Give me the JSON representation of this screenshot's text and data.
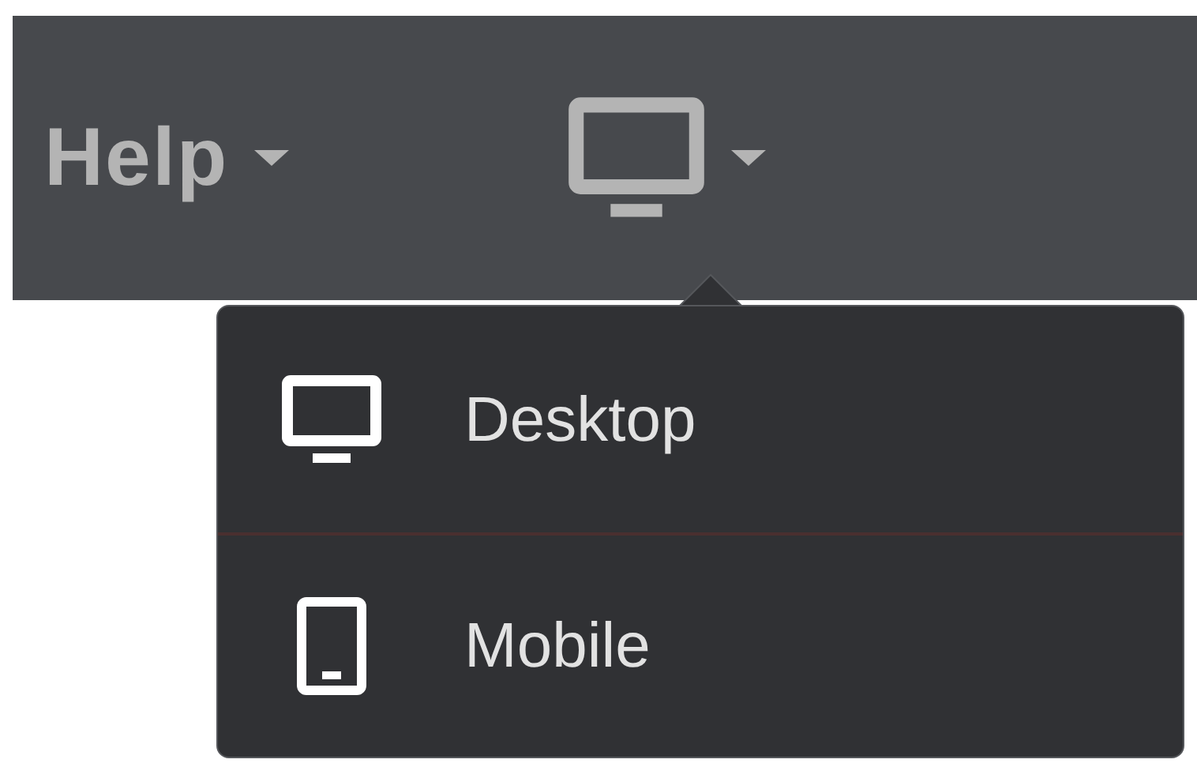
{
  "navbar": {
    "menus": [
      {
        "label": "Help",
        "kind": "text"
      },
      {
        "kind": "device"
      }
    ]
  },
  "device_menu": {
    "items": [
      {
        "label": "Desktop",
        "kind": "desktop"
      },
      {
        "label": "Mobile",
        "kind": "mobile"
      }
    ]
  }
}
